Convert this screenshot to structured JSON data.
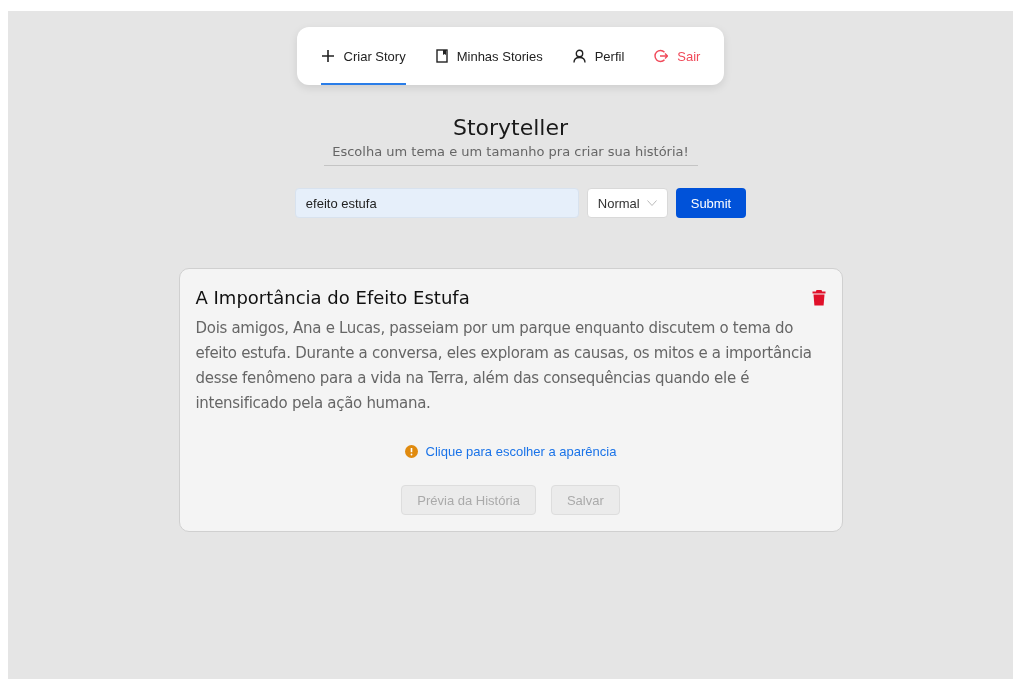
{
  "nav": {
    "tabs": [
      {
        "label": "Criar Story",
        "kind": "plus",
        "selected": true,
        "danger": false
      },
      {
        "label": "Minhas Stories",
        "kind": "book",
        "selected": false,
        "danger": false
      },
      {
        "label": "Perfil",
        "kind": "user",
        "selected": false,
        "danger": false
      },
      {
        "label": "Sair",
        "kind": "logout",
        "selected": false,
        "danger": true
      }
    ]
  },
  "header": {
    "title": "Storyteller",
    "subtitle": "Escolha um tema e um tamanho pra criar sua história!"
  },
  "form": {
    "topic": {
      "value": "efeito estufa"
    },
    "size": {
      "value": "Normal"
    },
    "submit": "Submit"
  },
  "story": {
    "title": "A Importância do Efeito Estufa",
    "text": "Dois amigos, Ana e Lucas, passeiam por um parque enquanto discutem o tema do efeito estufa. Durante a conversa, eles exploram as causas, os mitos e a importância desse fenômeno para a vida na Terra, além das consequências quando ele é intensificado pela ação humana.",
    "appearance_link": "Clique para escolher a aparência",
    "buttons": [
      {
        "label": "Prévia da História",
        "disabled": true
      },
      {
        "label": "Salvar",
        "disabled": true
      }
    ]
  }
}
